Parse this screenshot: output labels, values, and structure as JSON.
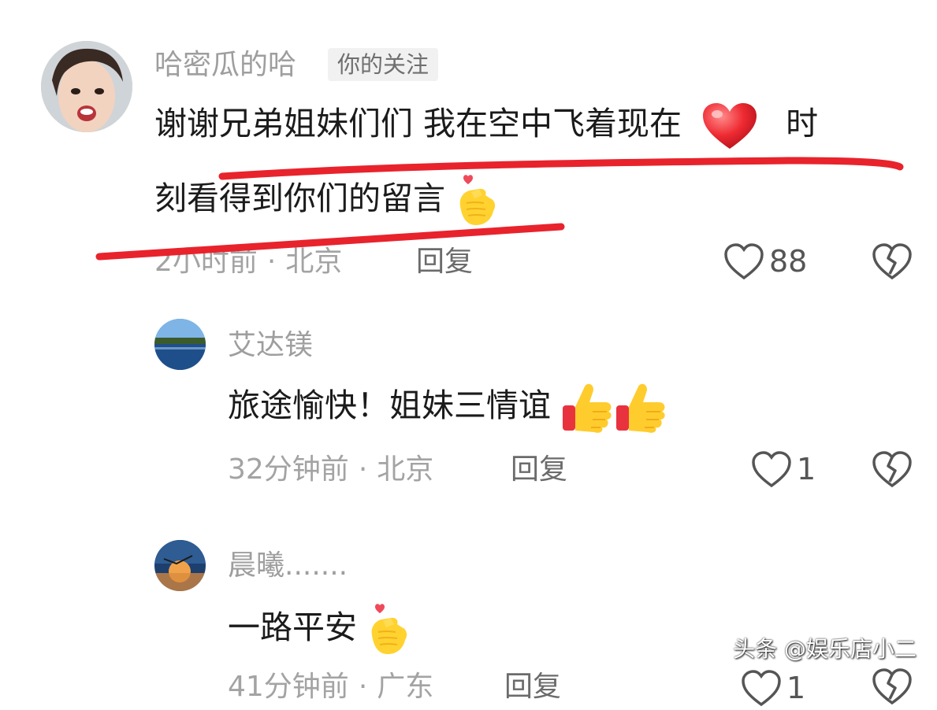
{
  "comments": [
    {
      "username": "哈密瓜的哈",
      "badge": "你的关注",
      "content_line1_a": "谢谢兄弟姐妹们们 我在空中飞着现在",
      "content_line1_b": "时",
      "content_line2": "刻看得到你们的留言",
      "time": "2小时前",
      "location": "北京",
      "reply_label": "回复",
      "like_count": "88",
      "emojis": [
        "red-heart",
        "finger-heart"
      ]
    },
    {
      "username": "艾达镁",
      "content": "旅途愉快！姐妹三情谊",
      "time": "32分钟前",
      "location": "北京",
      "reply_label": "回复",
      "like_count": "1",
      "emojis": [
        "thumbs-up",
        "thumbs-up"
      ]
    },
    {
      "username": "晨曦.......",
      "content": "一路平安",
      "time": "41分钟前",
      "location": "广东",
      "reply_label": "回复",
      "like_count": "1",
      "emojis": [
        "finger-heart"
      ]
    }
  ],
  "separator": "·",
  "watermark": "头条 @娱乐店小二",
  "colors": {
    "annotation_red": "#e8232c",
    "username_gray": "#9e9e9e",
    "meta_gray": "#a3a3a3",
    "badge_bg": "#f1f1f1"
  }
}
